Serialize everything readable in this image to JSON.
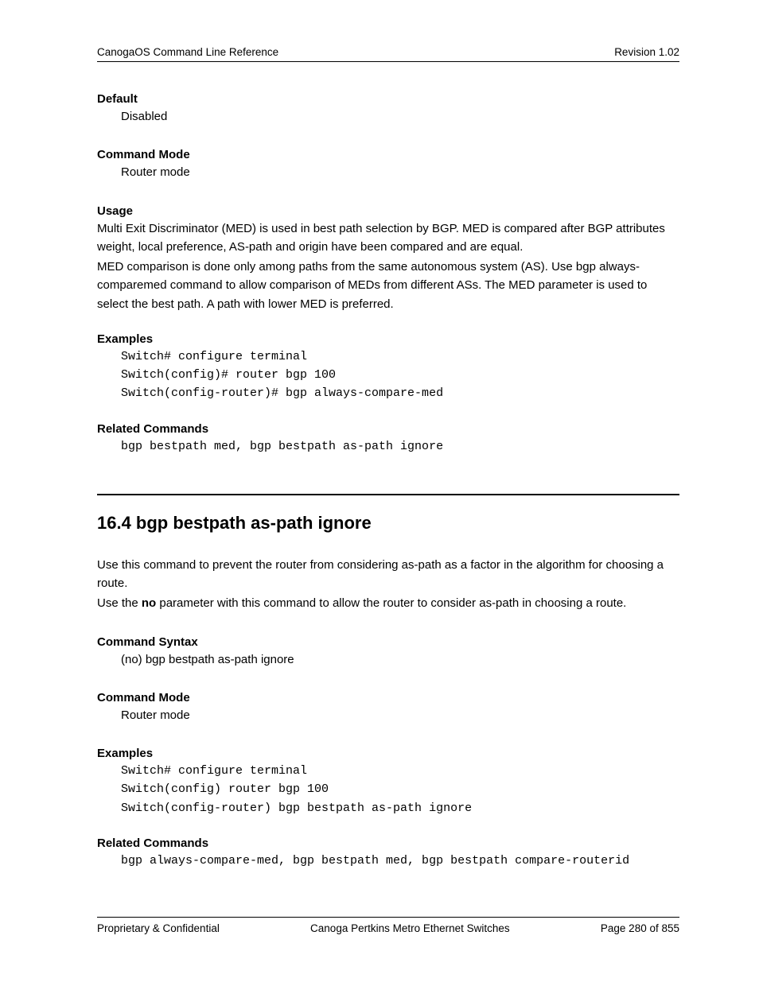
{
  "header": {
    "left": "CanogaOS Command Line Reference",
    "right": "Revision 1.02"
  },
  "sec1": {
    "default_h": "Default",
    "default_v": "Disabled",
    "mode_h": "Command Mode",
    "mode_v": "Router mode",
    "usage_h": "Usage",
    "usage_p1": "Multi Exit Discriminator (MED) is used in best path selection by BGP. MED is compared after BGP attributes weight, local preference, AS-path and origin have been compared and are equal.",
    "usage_p2": "MED comparison is done only among paths from the same autonomous system (AS). Use bgp always-comparemed command to allow comparison of MEDs from different ASs. The MED parameter is used to select the best path. A path with lower MED is preferred.",
    "examples_h": "Examples",
    "examples_code": "Switch# configure terminal\nSwitch(config)# router bgp 100\nSwitch(config-router)# bgp always-compare-med",
    "related_h": "Related Commands",
    "related_code": "bgp bestpath med, bgp bestpath as-path ignore"
  },
  "sec2": {
    "title": "16.4 bgp bestpath as-path ignore",
    "intro1": "Use this command to prevent the router from considering as-path as a factor in the algorithm for choosing a route.",
    "intro2a": "Use the ",
    "intro2b": "no",
    "intro2c": " parameter with this command to allow the router to consider as-path in choosing a route.",
    "syntax_h": "Command Syntax",
    "syntax_v": "(no) bgp bestpath as-path ignore",
    "mode_h": "Command Mode",
    "mode_v": "Router mode",
    "examples_h": "Examples",
    "examples_code": "Switch# configure terminal\nSwitch(config) router bgp 100\nSwitch(config-router) bgp bestpath as-path ignore",
    "related_h": "Related Commands",
    "related_code": "bgp always-compare-med, bgp bestpath med, bgp bestpath compare-routerid"
  },
  "footer": {
    "left": "Proprietary & Confidential",
    "mid": "Canoga Pertkins Metro Ethernet Switches",
    "right": "Page 280 of 855"
  }
}
